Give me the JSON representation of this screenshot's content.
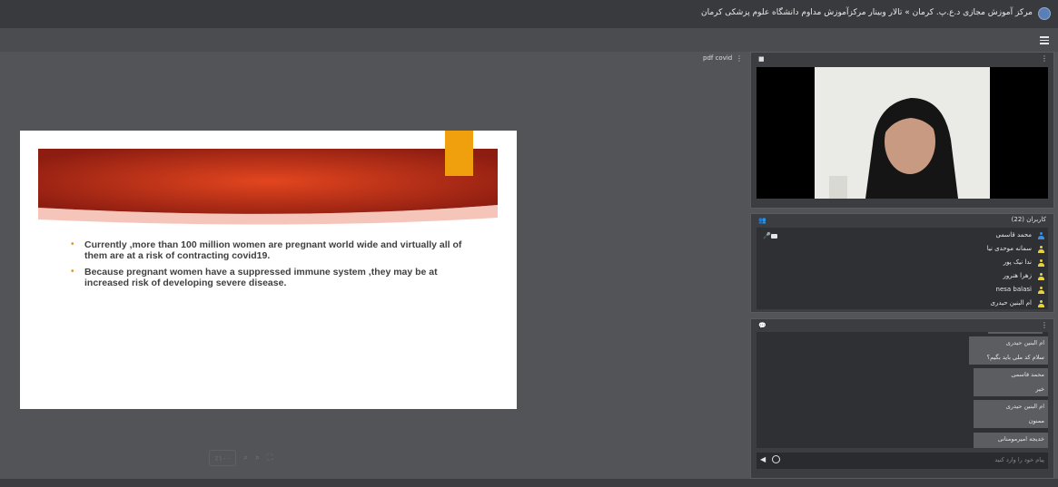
{
  "topbar": {
    "title": "مرکز آموزش مجازی د.ع.پ. کرمان » تالار وبینار مرکزآموزش مداوم دانشگاه علوم پزشکی کرمان"
  },
  "presentation": {
    "label": "pdf covid",
    "menu": "⋮",
    "bullets": [
      "Currently ,more than 100 million women are pregnant world wide and virtually all of them are at a risk of contracting covid19.",
      "Because pregnant women have a suppressed immune system ,they may be at increased risk of developing severe disease."
    ],
    "zoom_label": "٪۱۰۰"
  },
  "users": {
    "title": "کاربران (22)",
    "list": [
      {
        "name": "محمد قاسمی",
        "color": "#3a8ee6"
      },
      {
        "name": "سمانه موحدی نیا",
        "color": "#e6d23a"
      },
      {
        "name": "ندا نیک پور",
        "color": "#e6d23a"
      },
      {
        "name": "زهرا هنرور",
        "color": "#e6d23a"
      },
      {
        "name": "nesa balasi",
        "color": "#e6d23a"
      },
      {
        "name": "ام البنین حیدری",
        "color": "#e6d23a"
      }
    ]
  },
  "chat": {
    "messages": [
      {
        "name": "ام البنین حیدری",
        "text": "سلام کد ملی باید بگیم؟"
      },
      {
        "name": "محمد قاسمی",
        "text": "خیر"
      },
      {
        "name": "ام البنین حیدری",
        "text": "ممنون"
      },
      {
        "name": "خدیجه امیرمومنانی",
        "text": ""
      }
    ],
    "placeholder": "پیام خود را وارد کنید"
  },
  "colors": {
    "banner_dark": "#8e1d11",
    "banner_light": "#e3461f",
    "accent_tab": "#f0a00c"
  }
}
